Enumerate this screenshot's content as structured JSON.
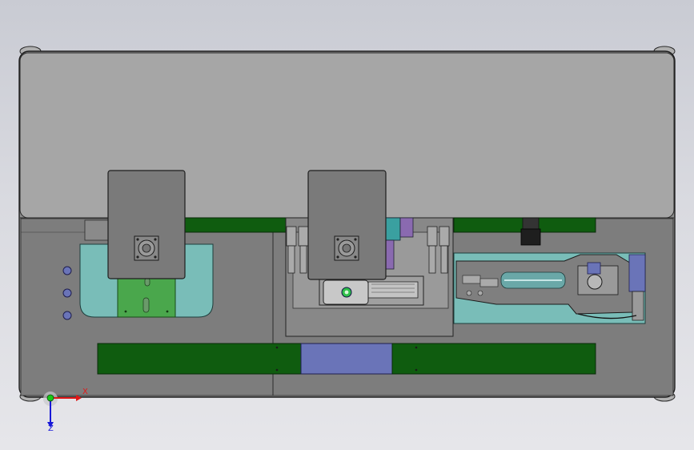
{
  "axis_triad": {
    "x_label": "X",
    "z_label": "Z",
    "x_color": "#e01818",
    "y_color": "#18c818",
    "z_color": "#1818d8"
  },
  "colors": {
    "background": "#d4d5db",
    "housing": "#a4a4a4",
    "plate": "#7c7c7c",
    "rail_green": "#0f5c0f",
    "slider_blue": "#6a74b8",
    "teal": "#79bdb8",
    "bright_green": "#4aa74c",
    "motor_gray": "#7a7a7a"
  },
  "icons": {
    "axis": "coordinate-triad-icon",
    "motor_flange": "square-flange-icon",
    "indicator": "round-indicator-icon"
  }
}
